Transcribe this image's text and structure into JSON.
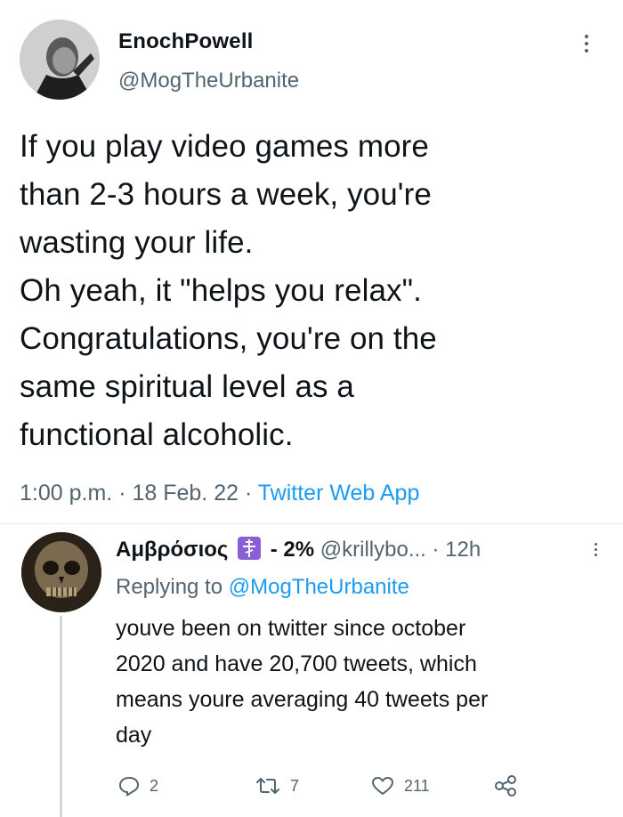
{
  "tweet": {
    "display_name": "EnochPowell",
    "handle": "@MogTheUrbanite",
    "text": "If you play video games more\nthan 2-3 hours a week, you're\nwasting your life.\nOh yeah, it \"helps you relax\".\nCongratulations, you're on the\nsame spiritual level as a\nfunctional alcoholic.",
    "time": "1:00 p.m.",
    "date": "18 Feb. 22",
    "source": "Twitter Web App",
    "separator": "·"
  },
  "reply": {
    "display_name": "Αμβρόσιος",
    "badge": "- 2%",
    "handle": "@krillybo...",
    "time": "· 12h",
    "replying_prefix": "Replying to",
    "replying_to": "@MogTheUrbanite",
    "text": "youve been on twitter since october\n2020 and have 20,700 tweets, which\nmeans youre averaging 40 tweets per\nday",
    "actions": {
      "reply_count": "2",
      "retweet_count": "7",
      "like_count": "211"
    }
  },
  "colors": {
    "link": "#1d9bf0",
    "secondary_text": "#536471",
    "cross_badge": "#8a5ed6"
  }
}
